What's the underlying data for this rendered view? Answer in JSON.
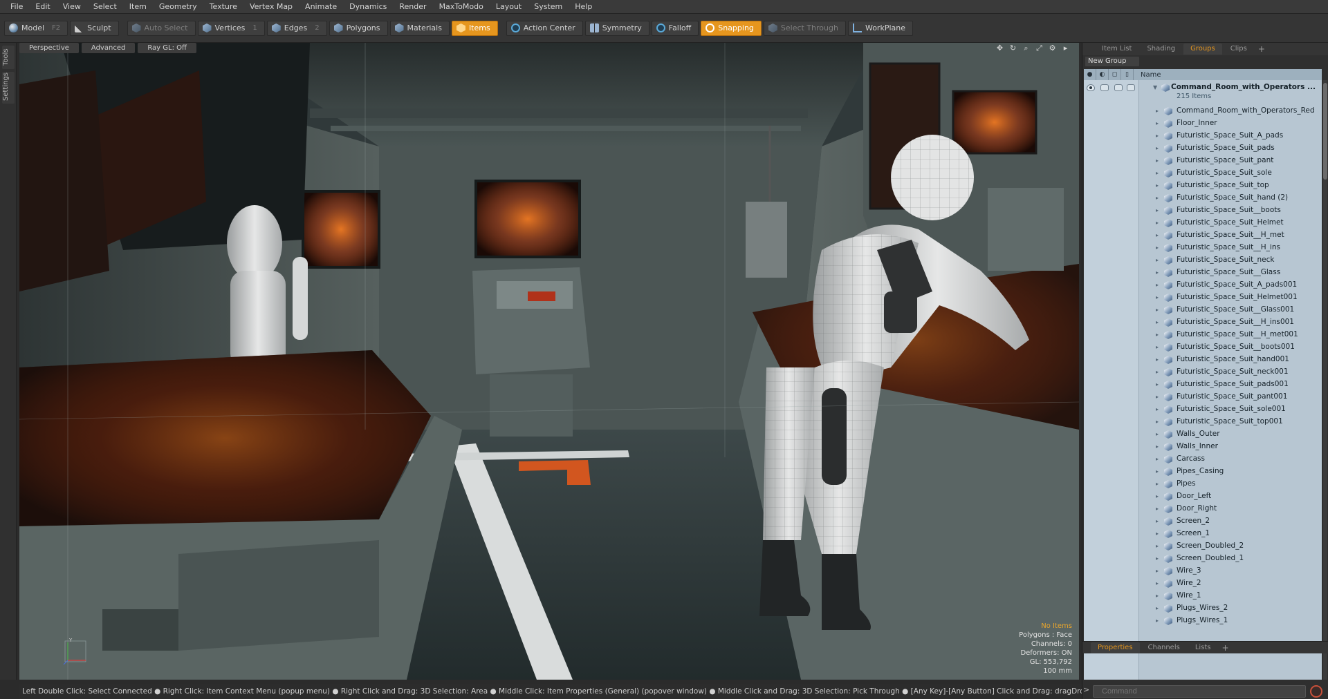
{
  "menu": [
    "File",
    "Edit",
    "View",
    "Select",
    "Item",
    "Geometry",
    "Texture",
    "Vertex Map",
    "Animate",
    "Dynamics",
    "Render",
    "MaxToModo",
    "Layout",
    "System",
    "Help"
  ],
  "toolbar": {
    "model": "Model",
    "model_shortcut": "F2",
    "sculpt": "Sculpt",
    "auto_select": "Auto Select",
    "vertices": "Vertices",
    "vertices_shortcut": "1",
    "edges": "Edges",
    "edges_shortcut": "2",
    "polygons": "Polygons",
    "materials": "Materials",
    "items": "Items",
    "action_center": "Action Center",
    "symmetry": "Symmetry",
    "falloff": "Falloff",
    "snapping": "Snapping",
    "select_through": "Select Through",
    "workplane": "WorkPlane",
    "accent_color": "#e6961e"
  },
  "left_tabs": [
    "Tools",
    "Settings"
  ],
  "viewport": {
    "tabs": [
      "Perspective",
      "Advanced",
      "Ray GL: Off"
    ],
    "info": {
      "items": "No Items",
      "polygons": "Polygons : Face",
      "channels": "Channels: 0",
      "deformers": "Deformers: ON",
      "gl": "GL: 553,792",
      "scale": "100 mm"
    },
    "axis_label": "Y"
  },
  "right_panel": {
    "tabs": [
      "Item List",
      "Shading",
      "Groups",
      "Clips"
    ],
    "active_tab": "Groups",
    "new_group": "New Group",
    "column_name": "Name",
    "root": {
      "name": "Command_Room_with_Operators ...",
      "count": "215 Items"
    },
    "items": [
      "Command_Room_with_Operators_Red",
      "Floor_Inner",
      "Futuristic_Space_Suit_A_pads",
      "Futuristic_Space_Suit_pads",
      "Futuristic_Space_Suit_pant",
      "Futuristic_Space_Suit_sole",
      "Futuristic_Space_Suit_top",
      "Futuristic_Space_Suit_hand (2)",
      "Futuristic_Space_Suit__boots",
      "Futuristic_Space_Suit_Helmet",
      "Futuristic_Space_Suit__H_met",
      "Futuristic_Space_Suit__H_ins",
      "Futuristic_Space_Suit_neck",
      "Futuristic_Space_Suit__Glass",
      "Futuristic_Space_Suit_A_pads001",
      "Futuristic_Space_Suit_Helmet001",
      "Futuristic_Space_Suit__Glass001",
      "Futuristic_Space_Suit__H_ins001",
      "Futuristic_Space_Suit__H_met001",
      "Futuristic_Space_Suit__boots001",
      "Futuristic_Space_Suit_hand001",
      "Futuristic_Space_Suit_neck001",
      "Futuristic_Space_Suit_pads001",
      "Futuristic_Space_Suit_pant001",
      "Futuristic_Space_Suit_sole001",
      "Futuristic_Space_Suit_top001",
      "Walls_Outer",
      "Walls_Inner",
      "Carcass",
      "Pipes_Casing",
      "Pipes",
      "Door_Left",
      "Door_Right",
      "Screen_2",
      "Screen_1",
      "Screen_Doubled_2",
      "Screen_Doubled_1",
      "Wire_3",
      "Wire_2",
      "Wire_1",
      "Plugs_Wires_2",
      "Plugs_Wires_1"
    ],
    "bottom_tabs": [
      "Properties",
      "Channels",
      "Lists"
    ],
    "bottom_active": "Properties"
  },
  "statusbar": "Left Double Click: Select Connected ● Right Click: Item Context Menu (popup menu) ● Right Click and Drag: 3D Selection: Area ● Middle Click: Item Properties (General) (popover window) ● Middle Click and Drag: 3D Selection: Pick Through ● [Any Key]-[Any Button] Click and Drag: dragDropBegin",
  "command": {
    "placeholder": "Command"
  }
}
